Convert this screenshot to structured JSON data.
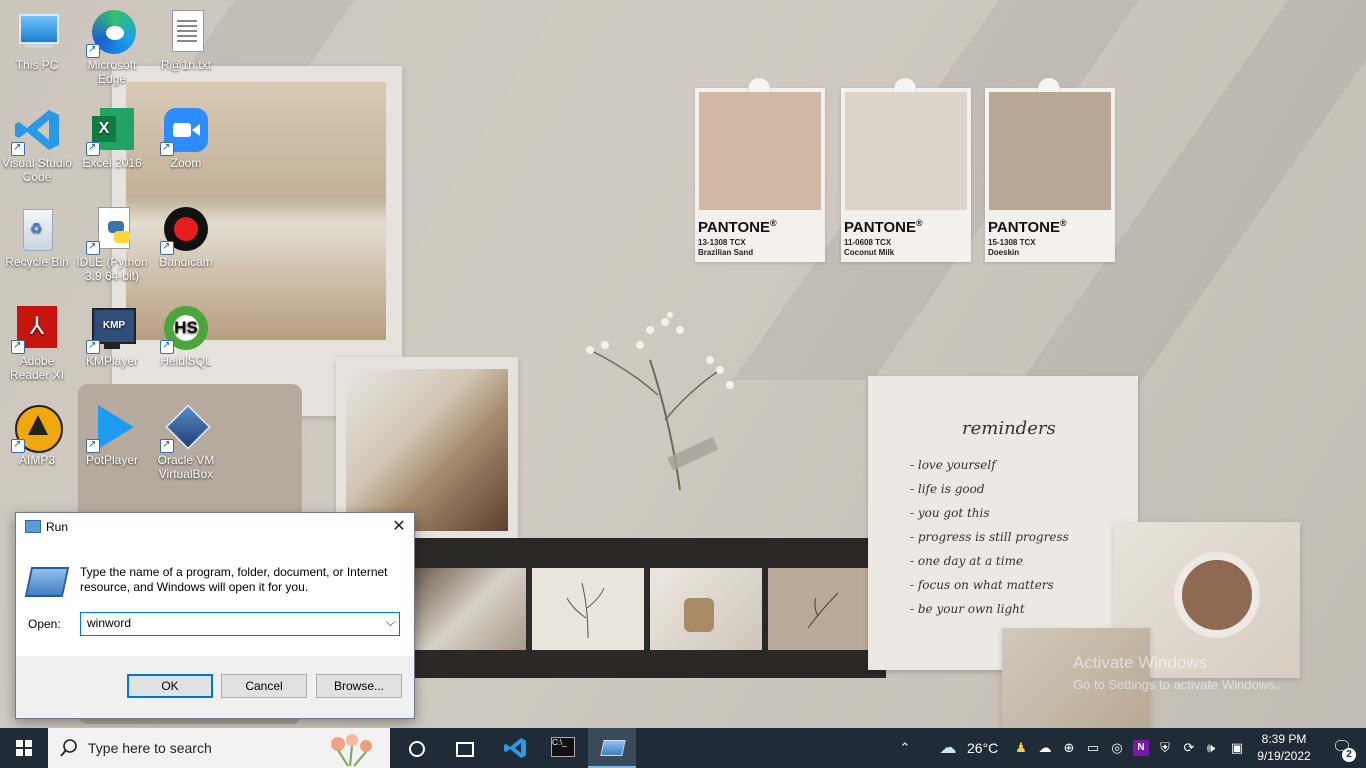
{
  "desktop_icons": [
    {
      "label": "This PC",
      "icon": "this-pc-icon"
    },
    {
      "label": "Microsoft Edge",
      "icon": "edge-icon"
    },
    {
      "label": "R@1n.txt",
      "icon": "text-file-icon"
    },
    {
      "label": "Visual Studio Code",
      "icon": "vscode-icon"
    },
    {
      "label": "Excel 2016",
      "icon": "excel-icon"
    },
    {
      "label": "Zoom",
      "icon": "zoom-icon"
    },
    {
      "label": "Recycle Bin",
      "icon": "recycle-bin-icon"
    },
    {
      "label": "IDLE (Python 3.9 64-bit)",
      "icon": "python-idle-icon"
    },
    {
      "label": "Bandicam",
      "icon": "bandicam-icon"
    },
    {
      "label": "Adobe Reader XI",
      "icon": "adobe-reader-icon"
    },
    {
      "label": "KMPlayer",
      "icon": "kmplayer-icon"
    },
    {
      "label": "HeidiSQL",
      "icon": "heidisql-icon"
    },
    {
      "label": "AIMP3",
      "icon": "aimp-icon"
    },
    {
      "label": "PotPlayer",
      "icon": "potplayer-icon"
    },
    {
      "label": "Oracle VM VirtualBox",
      "icon": "virtualbox-icon"
    }
  ],
  "wallpaper": {
    "pantone": [
      {
        "brand": "PANTONE",
        "code": "13-1308 TCX",
        "name": "Brazilian Sand",
        "color": "#cfb9a6"
      },
      {
        "brand": "PANTONE",
        "code": "11-0608 TCX",
        "name": "Coconut Milk",
        "color": "#ddd5cb"
      },
      {
        "brand": "PANTONE",
        "code": "15-1308 TCX",
        "name": "Doeskin",
        "color": "#b9a796"
      }
    ],
    "reminders": {
      "title": "reminders",
      "items": [
        "- love yourself",
        "- life is good",
        "- you got this",
        "- progress is still progress",
        "- one day at a time",
        "- focus on what matters",
        "- be your own light"
      ]
    },
    "watermark": {
      "line1": "Activate Windows",
      "line2": "Go to Settings to activate Windows."
    }
  },
  "run_dialog": {
    "title": "Run",
    "description": "Type the name of a program, folder, document, or Internet resource, and Windows will open it for you.",
    "open_label": "Open:",
    "open_value": "winword",
    "ok_label": "OK",
    "cancel_label": "Cancel",
    "browse_label": "Browse..."
  },
  "taskbar": {
    "search_placeholder": "Type here to search",
    "weather": "26°C",
    "time": "8:39 PM",
    "date": "9/19/2022",
    "notification_count": "2"
  },
  "colors": {
    "taskbar_bg": "#1f2b37",
    "accent": "#0078d7"
  }
}
